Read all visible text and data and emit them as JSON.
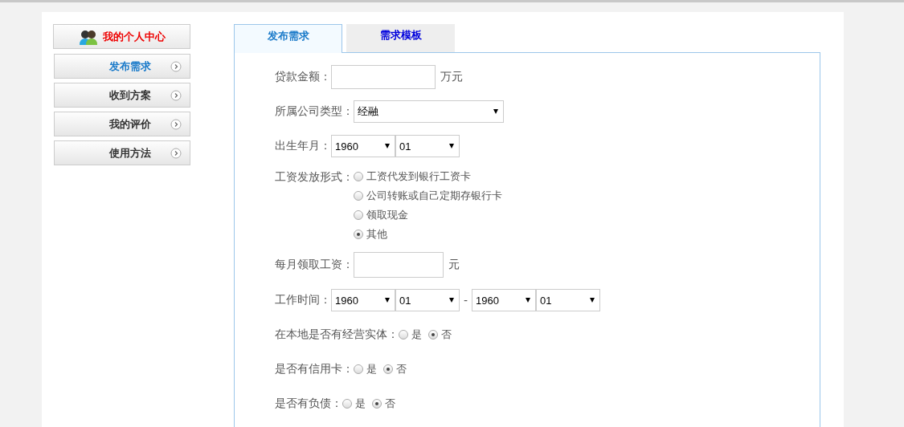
{
  "sidebar": {
    "header": "我的个人中心",
    "items": [
      {
        "label": "发布需求",
        "selected": true
      },
      {
        "label": "收到方案",
        "selected": false
      },
      {
        "label": "我的评价",
        "selected": false
      },
      {
        "label": "使用方法",
        "selected": false
      }
    ]
  },
  "tabs": [
    {
      "label": "发布需求",
      "selected": true
    },
    {
      "label": "需求模板",
      "selected": false
    }
  ],
  "form": {
    "rows": [
      {
        "kind": "input",
        "label": "贷款金额：",
        "unit": "万元"
      },
      {
        "kind": "select",
        "label": "所属公司类型：",
        "selects": [
          {
            "value": "经融"
          }
        ]
      },
      {
        "kind": "select",
        "label": "出生年月：",
        "selects": [
          {
            "value": "1960"
          },
          {
            "value": "01"
          }
        ]
      },
      {
        "kind": "radio-list",
        "label": "工资发放形式：",
        "options": [
          {
            "label": "工资代发到银行工资卡",
            "selected": false
          },
          {
            "label": "公司转账或自己定期存银行卡",
            "selected": false
          },
          {
            "label": "领取现金",
            "selected": false
          },
          {
            "label": "其他",
            "selected": true
          }
        ]
      },
      {
        "kind": "input",
        "label": "每月领取工资：",
        "unit": "元"
      },
      {
        "kind": "range",
        "label": "工作时间：",
        "separator": "-",
        "from": [
          {
            "value": "1960"
          },
          {
            "value": "01"
          }
        ],
        "to": [
          {
            "value": "1960"
          },
          {
            "value": "01"
          }
        ]
      },
      {
        "kind": "radio-inline",
        "label": "在本地是否有经营实体：",
        "options": [
          {
            "label": "是",
            "selected": false
          },
          {
            "label": "否",
            "selected": true
          }
        ]
      },
      {
        "kind": "radio-inline",
        "label": "是否有信用卡：",
        "options": [
          {
            "label": "是",
            "selected": false
          },
          {
            "label": "否",
            "selected": true
          }
        ]
      },
      {
        "kind": "radio-inline",
        "label": "是否有负债：",
        "options": [
          {
            "label": "是",
            "selected": false
          },
          {
            "label": "否",
            "selected": true
          }
        ]
      }
    ]
  }
}
